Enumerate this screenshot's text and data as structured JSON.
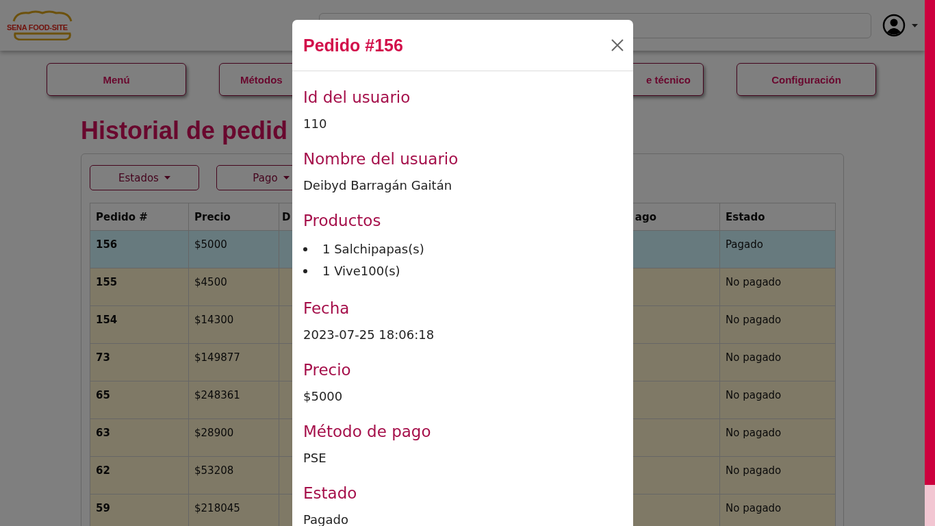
{
  "header": {
    "logo_text": "SENA FOOD-SITE"
  },
  "nav": [
    "Menú",
    "Métodos",
    "e técnico",
    "Configuración"
  ],
  "page_title": "Historial de pedid",
  "filters": [
    "Estados",
    "Pago"
  ],
  "table": {
    "columns": [
      "Pedido #",
      "Precio",
      "D",
      "ago",
      "Estado"
    ],
    "rows": [
      {
        "pedido": "156",
        "precio": "$5000",
        "estado": "Pagado",
        "paid": true
      },
      {
        "pedido": "155",
        "precio": "$4500",
        "estado": "No pagado",
        "paid": false
      },
      {
        "pedido": "154",
        "precio": "$14300",
        "estado": "No pagado",
        "paid": false
      },
      {
        "pedido": "73",
        "precio": "$149877",
        "estado": "No pagado",
        "paid": false
      },
      {
        "pedido": "65",
        "precio": "$248361",
        "estado": "No pagado",
        "paid": false
      },
      {
        "pedido": "63",
        "precio": "$28900",
        "estado": "No pagado",
        "paid": false
      },
      {
        "pedido": "62",
        "precio": "$53208",
        "estado": "No pagado",
        "paid": false
      },
      {
        "pedido": "59",
        "precio": "$218045",
        "estado": "No pagado",
        "paid": false
      }
    ]
  },
  "modal": {
    "title": "Pedido #156",
    "sections": [
      {
        "kind": "text",
        "label": "Id del usuario",
        "value": "110"
      },
      {
        "kind": "text",
        "label": "Nombre del usuario",
        "value": "Deibyd Barragán Gaitán"
      },
      {
        "kind": "list",
        "label": "Productos",
        "items": [
          "1 Salchipapas(s)",
          "1 Vive100(s)"
        ]
      },
      {
        "kind": "text",
        "label": "Fecha",
        "value": "2023-07-25 18:06:18"
      },
      {
        "kind": "text",
        "label": "Precio",
        "value": "$5000"
      },
      {
        "kind": "text",
        "label": "Método de pago",
        "value": "PSE"
      },
      {
        "kind": "text",
        "label": "Estado",
        "value": "Pagado"
      }
    ]
  }
}
